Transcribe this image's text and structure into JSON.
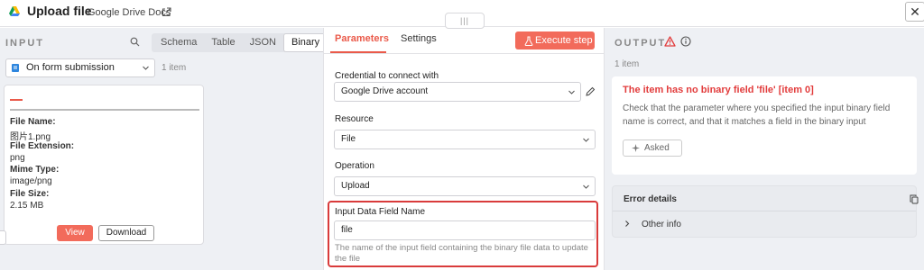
{
  "header": {
    "title": "Upload file",
    "subtitle": "Google Drive Docs",
    "drag_handle": "|||"
  },
  "input_panel": {
    "label": "INPUT",
    "view_tabs": [
      "Schema",
      "Table",
      "JSON",
      "Binary"
    ],
    "active_view": "Binary",
    "trigger": "On form submission",
    "item_count": "1 item",
    "binary": {
      "file_name_label": "File Name:",
      "file_name": "图片1.png",
      "extension_label": "File Extension:",
      "extension": "png",
      "mime_label": "Mime Type:",
      "mime": "image/png",
      "size_label": "File Size:",
      "size": "2.15 MB",
      "view_label": "View",
      "download_label": "Download"
    }
  },
  "params_panel": {
    "tabs": [
      "Parameters",
      "Settings"
    ],
    "active_tab": "Parameters",
    "execute_label": "Execute step",
    "credential_label": "Credential to connect with",
    "credential_value": "Google Drive account",
    "resource_label": "Resource",
    "resource_value": "File",
    "operation_label": "Operation",
    "operation_value": "Upload",
    "field_label": "Input Data Field Name",
    "field_value": "file",
    "field_hint": "The name of the input field containing the binary file data to update the file"
  },
  "output_panel": {
    "label": "OUTPUT",
    "item_count": "1 item",
    "error_title": "The item has no binary field 'file' [item 0]",
    "error_message": "Check that the parameter where you specified the input binary field name is correct, and that it matches a field in the binary input",
    "asked_label": "Asked",
    "details_label": "Error details",
    "other_info_label": "Other info"
  },
  "colors": {
    "accent": "#ea5a4a",
    "error": "#e23c3c",
    "highlight": "#d93b3b"
  }
}
